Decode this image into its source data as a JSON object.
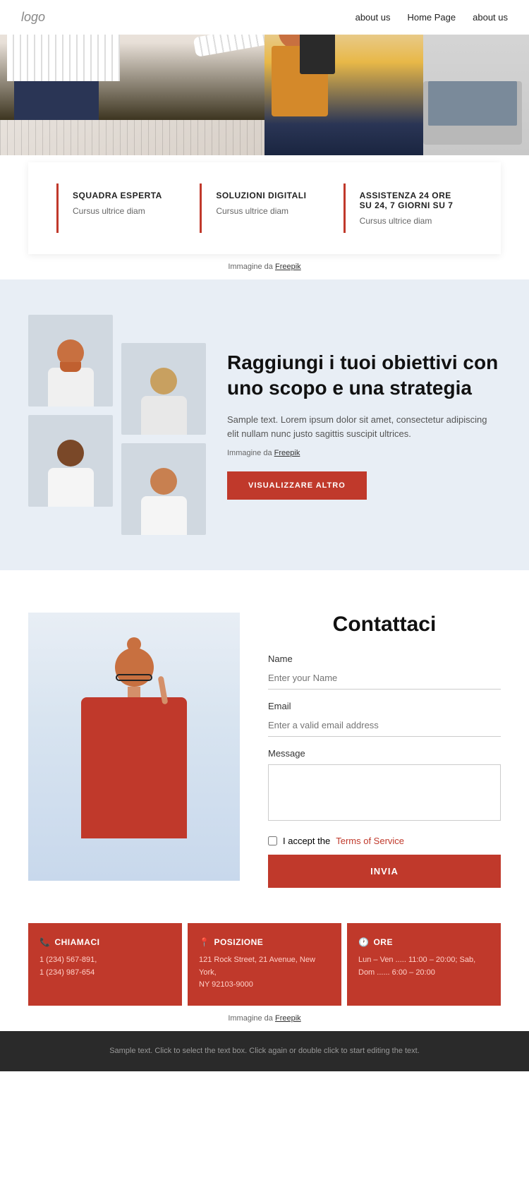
{
  "header": {
    "logo": "logo",
    "nav": [
      {
        "label": "about us",
        "href": "#"
      },
      {
        "label": "Home Page",
        "href": "#"
      },
      {
        "label": "about us",
        "href": "#"
      }
    ]
  },
  "hero": {
    "alt": "Office workers collaborating"
  },
  "features": {
    "items": [
      {
        "title": "SQUADRA ESPERTA",
        "desc": "Cursus ultrice diam"
      },
      {
        "title": "SOLUZIONI DIGITALI",
        "desc": "Cursus ultrice diam"
      },
      {
        "title": "ASSISTENZA 24 ORE SU 24, 7 GIORNI SU 7",
        "desc": "Cursus ultrice diam"
      }
    ]
  },
  "hero_attribution": "Immagine da",
  "hero_attribution_link": "Freepik",
  "team": {
    "heading": "Raggiungi i tuoi obiettivi con uno scopo e una strategia",
    "text": "Sample text. Lorem ipsum dolor sit amet, consectetur adipiscing elit nullam nunc justo sagittis suscipit ultrices.",
    "attribution_prefix": "Immagine da",
    "attribution_link": "Freepik",
    "button_label": "VISUALIZZARE ALTRO"
  },
  "contact": {
    "title": "Contattaci",
    "form": {
      "name_label": "Name",
      "name_placeholder": "Enter your Name",
      "email_label": "Email",
      "email_placeholder": "Enter a valid email address",
      "message_label": "Message",
      "message_placeholder": "",
      "terms_prefix": "I accept the",
      "terms_link": "Terms of Service",
      "submit_label": "INVIA"
    }
  },
  "info_cards": [
    {
      "icon": "📞",
      "title": "CHIAMACI",
      "lines": [
        "1 (234) 567-891,",
        "1 (234) 987-654"
      ]
    },
    {
      "icon": "📍",
      "title": "POSIZIONE",
      "lines": [
        "121 Rock Street, 21 Avenue, New York,",
        "NY 92103-9000"
      ]
    },
    {
      "icon": "🕐",
      "title": "ORE",
      "lines": [
        "Lun – Ven ..... 11:00 – 20:00; Sab,",
        "Dom ...... 6:00 – 20:00"
      ]
    }
  ],
  "footer_attribution": "Immagine da",
  "footer_attribution_link": "Freepik",
  "footer": {
    "text": "Sample text. Click to select the text box. Click again or double click to start editing the text."
  },
  "colors": {
    "accent": "#c0392b",
    "bg_light": "#e8eef5"
  }
}
